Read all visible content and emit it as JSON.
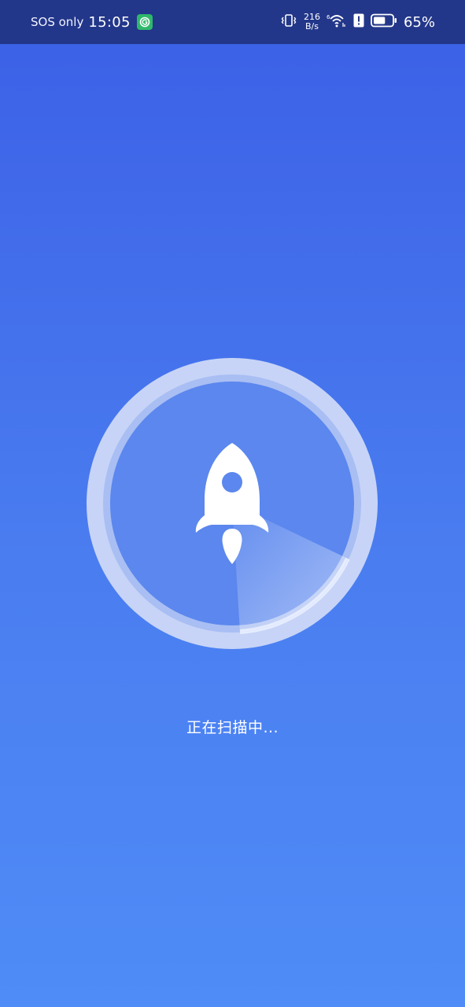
{
  "status_bar": {
    "carrier": "SOS only",
    "time": "15:05",
    "net_speed_value": "216",
    "net_speed_unit": "B/s",
    "battery_percent": "65%",
    "battery_level": 0.65,
    "background": "#23378a"
  },
  "scan": {
    "status_text": "正在扫描中..."
  },
  "colors": {
    "gradient_top": "#3b5fe6",
    "gradient_bottom": "#4f8cf7"
  }
}
